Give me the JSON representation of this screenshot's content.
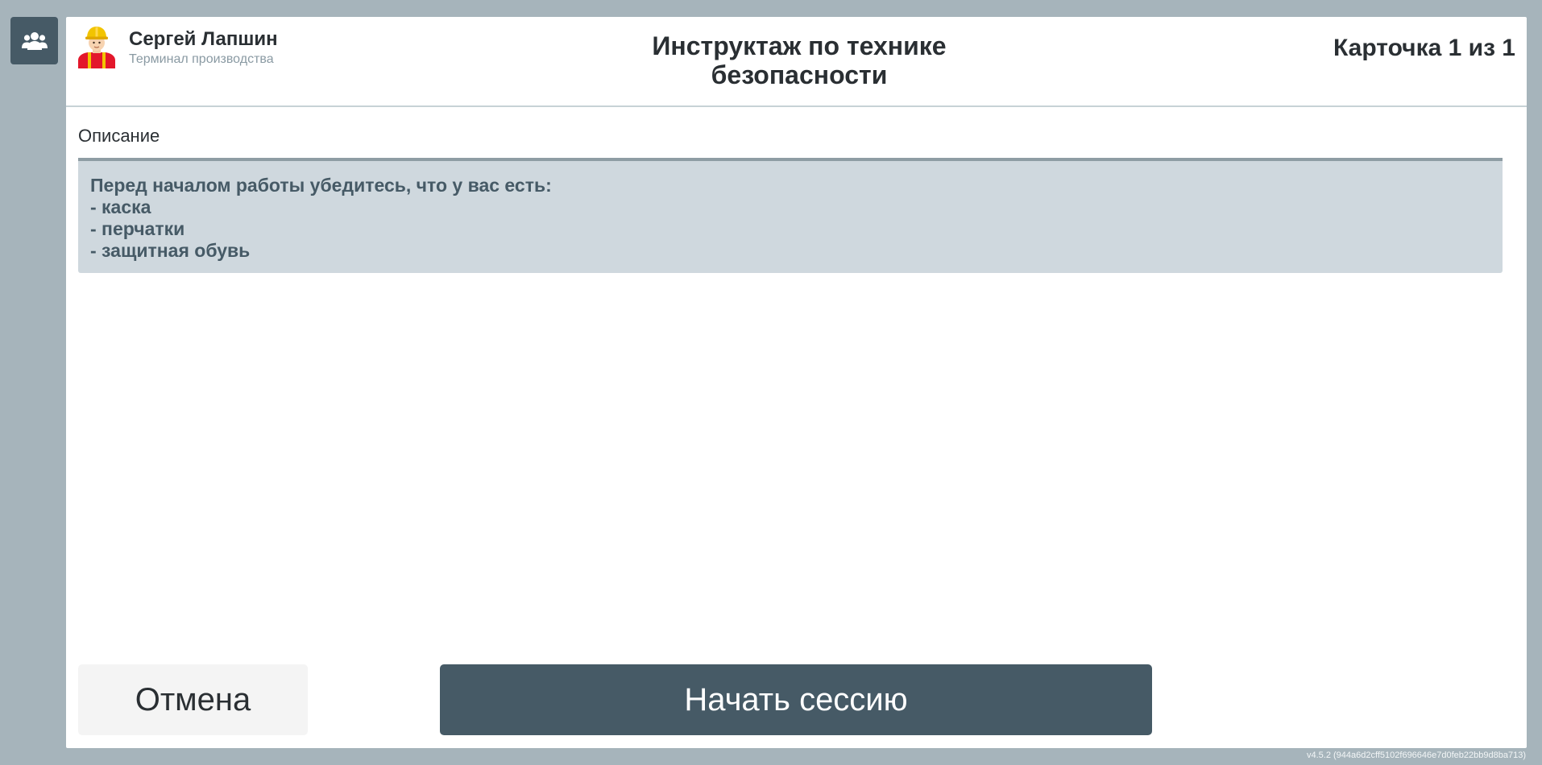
{
  "sidebar": {
    "users_button_icon": "users-icon"
  },
  "header": {
    "avatar_icon": "worker-hard-hat-avatar",
    "user_name": "Сергей Лапшин",
    "user_role": "Терминал производства",
    "title": "Инструктаж по технике безопасности",
    "card_counter": "Карточка 1 из 1"
  },
  "description": {
    "label": "Описание",
    "lines": [
      "Перед началом работы убедитесь, что у вас есть:",
      "- каска",
      "- перчатки",
      "- защитная обувь"
    ]
  },
  "actions": {
    "cancel_label": "Отмена",
    "start_label": "Начать сессию"
  },
  "footer": {
    "version": "v4.5.2 (944a6d2cff5102f696646e7d0feb22bb9d8ba713)"
  },
  "colors": {
    "background": "#a6b4bb",
    "accent": "#465a66",
    "description_bg": "#cfd8de",
    "cancel_bg": "#f4f4f4"
  }
}
